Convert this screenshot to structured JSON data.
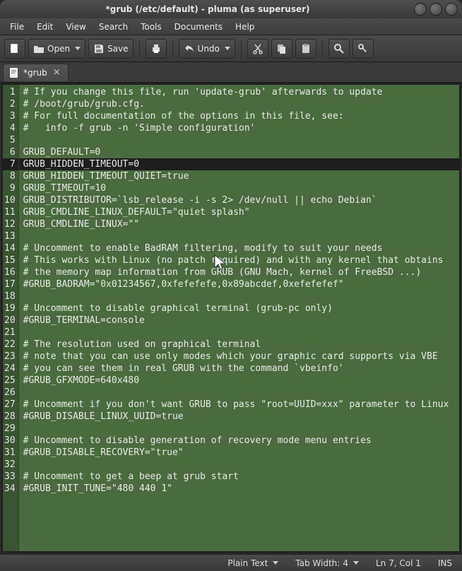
{
  "window": {
    "title": "*grub (/etc/default) - pluma (as superuser)"
  },
  "menu": {
    "items": [
      "File",
      "Edit",
      "View",
      "Search",
      "Tools",
      "Documents",
      "Help"
    ]
  },
  "toolbar": {
    "open_label": "Open",
    "save_label": "Save",
    "undo_label": "Undo"
  },
  "tab": {
    "label": "*grub"
  },
  "editor": {
    "current_line": 7,
    "lines": [
      "# If you change this file, run 'update-grub' afterwards to update",
      "# /boot/grub/grub.cfg.",
      "# For full documentation of the options in this file, see:",
      "#   info -f grub -n 'Simple configuration'",
      "",
      "GRUB_DEFAULT=0",
      "GRUB_HIDDEN_TIMEOUT=0",
      "GRUB_HIDDEN_TIMEOUT_QUIET=true",
      "GRUB_TIMEOUT=10",
      "GRUB_DISTRIBUTOR=`lsb_release -i -s 2> /dev/null || echo Debian`",
      "GRUB_CMDLINE_LINUX_DEFAULT=\"quiet splash\"",
      "GRUB_CMDLINE_LINUX=\"\"",
      "",
      "# Uncomment to enable BadRAM filtering, modify to suit your needs",
      "# This works with Linux (no patch required) and with any kernel that obtains",
      "# the memory map information from GRUB (GNU Mach, kernel of FreeBSD ...)",
      "#GRUB_BADRAM=\"0x01234567,0xfefefefe,0x89abcdef,0xefefefef\"",
      "",
      "# Uncomment to disable graphical terminal (grub-pc only)",
      "#GRUB_TERMINAL=console",
      "",
      "# The resolution used on graphical terminal",
      "# note that you can use only modes which your graphic card supports via VBE",
      "# you can see them in real GRUB with the command `vbeinfo'",
      "#GRUB_GFXMODE=640x480",
      "",
      "# Uncomment if you don't want GRUB to pass \"root=UUID=xxx\" parameter to Linux",
      "#GRUB_DISABLE_LINUX_UUID=true",
      "",
      "# Uncomment to disable generation of recovery mode menu entries",
      "#GRUB_DISABLE_RECOVERY=\"true\"",
      "",
      "# Uncomment to get a beep at grub start",
      "#GRUB_INIT_TUNE=\"480 440 1\""
    ]
  },
  "status": {
    "language": "Plain Text",
    "tab_width_label": "Tab Width:",
    "tab_width_value": "4",
    "position": "Ln 7, Col 1",
    "insert_mode": "INS"
  }
}
